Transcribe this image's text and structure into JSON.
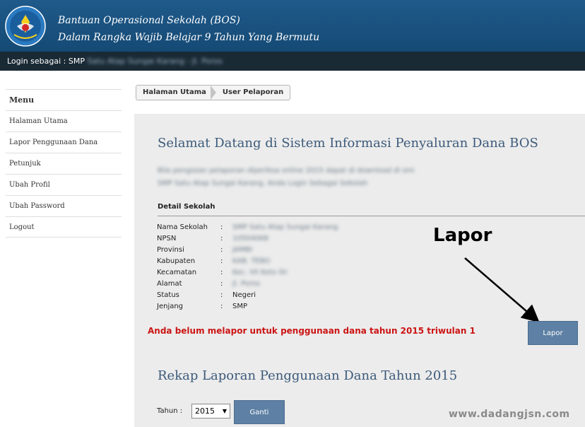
{
  "header": {
    "title_line1": "Bantuan Operasional Sekolah (BOS)",
    "title_line2": "Dalam Rangka Wajib Belajar 9 Tahun Yang Bermutu",
    "logo_icon": "tut-wuri-handayani-logo"
  },
  "login_bar": {
    "prefix": "Login sebagai : SMP",
    "blurred_name": "Satu Atap Sungai Karang - Jl. Poros"
  },
  "sidebar": {
    "items": [
      {
        "label": "Menu"
      },
      {
        "label": "Halaman Utama"
      },
      {
        "label": "Lapor Penggunaan Dana"
      },
      {
        "label": "Petunjuk"
      },
      {
        "label": "Ubah Profil"
      },
      {
        "label": "Ubah Password"
      },
      {
        "label": "Logout"
      }
    ]
  },
  "breadcrumb": {
    "home": "Halaman Utama",
    "current": "User Pelaporan"
  },
  "main": {
    "welcome_title": "Selamat Datang di Sistem Informasi Penyaluran Dana BOS",
    "blurred_line1": "Bila pengisian pelaporan diperiksa online 2015 dapat di download di sini",
    "blurred_line2": "SMP Satu Atap Sungai Karang, Anda Login Sebagai Sekolah",
    "detail_title": "Detail Sekolah",
    "details": [
      {
        "label": "Nama Sekolah",
        "sep": ":",
        "value": "SMP Satu Atap Sungai Karang",
        "blurred": true
      },
      {
        "label": "NPSN",
        "sep": ":",
        "value": "10504068",
        "blurred": true
      },
      {
        "label": "Provinsi",
        "sep": ":",
        "value": "JAMBI",
        "blurred": true
      },
      {
        "label": "Kabupaten",
        "sep": ":",
        "value": "KAB. TEBO",
        "blurred": true
      },
      {
        "label": "Kecamatan",
        "sep": ":",
        "value": "Kec. VII Koto Ilir",
        "blurred": true
      },
      {
        "label": "Alamat",
        "sep": ":",
        "value": "Jl. Poros",
        "blurred": true
      },
      {
        "label": "Status",
        "sep": ":",
        "value": "Negeri",
        "blurred": false
      },
      {
        "label": "Jenjang",
        "sep": ":",
        "value": "SMP",
        "blurred": false
      }
    ],
    "lapor_note": "Anda belum melapor untuk penggunaan dana tahun 2015 triwulan 1",
    "lapor_button": "Lapor",
    "annotation_label": "Lapor",
    "rekap_title": "Rekap Laporan Penggunaan Dana Tahun 2015",
    "tahun_label": "Tahun :",
    "tahun_selected": "2015",
    "ganti_button": "Ganti",
    "watermark": "www.dadangjsn.com"
  },
  "colors": {
    "header_bg": "#1f5a8a",
    "login_bar_bg": "#1a2a35",
    "heading_blue": "#3c5a7a",
    "button_bg": "#5d80a4",
    "warning_red": "#cc1414",
    "panel_bg": "#ececec"
  }
}
